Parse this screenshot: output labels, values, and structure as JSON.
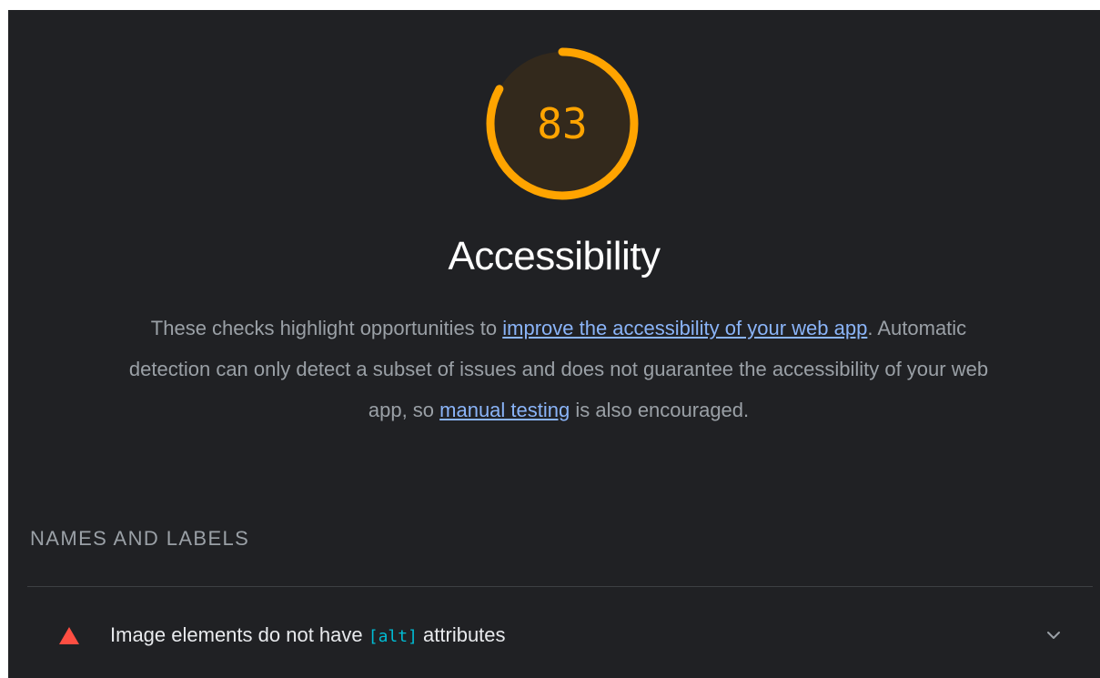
{
  "gauge": {
    "score": "83",
    "score_fraction": 0.83,
    "color": "#ffa400",
    "track_color": "#3a2f21"
  },
  "category": {
    "title": "Accessibility"
  },
  "description": {
    "text_1": "These checks highlight opportunities to ",
    "link_1": "improve the accessibility of your web app",
    "text_2": ". Automatic detection can only detect a subset of issues and does not guarantee the accessibility of your web app, so ",
    "link_2": "manual testing",
    "text_3": " is also encouraged."
  },
  "section": {
    "title": "NAMES AND LABELS"
  },
  "audits": [
    {
      "status": "fail",
      "status_icon": "triangle-fail-icon",
      "title_before": "Image elements do not have ",
      "title_code": "[alt]",
      "title_after": " attributes",
      "expand_icon": "chevron-down-icon"
    }
  ],
  "colors": {
    "background": "#202124",
    "link": "#8ab4f8",
    "fail": "#ff4e42",
    "code": "#00bcd4"
  }
}
